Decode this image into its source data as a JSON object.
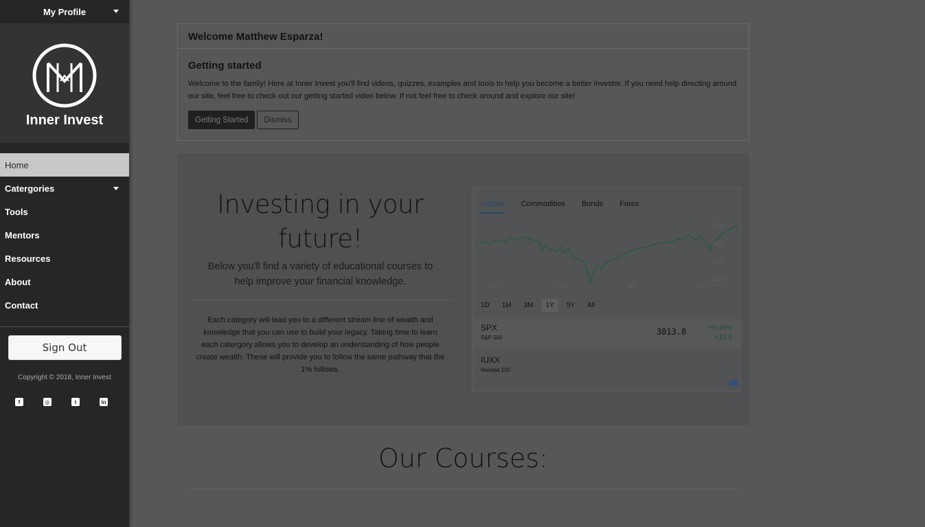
{
  "sidebar": {
    "profile_label": "My Profile",
    "brand_name": "Inner Invest",
    "nav": [
      {
        "label": "Home"
      },
      {
        "label": "Catergories"
      },
      {
        "label": "Tools"
      },
      {
        "label": "Mentors"
      },
      {
        "label": "Resources"
      },
      {
        "label": "About"
      },
      {
        "label": "Contact"
      }
    ],
    "sign_out": "Sign Out",
    "copyright": "Copyright © 2018, Inner Invest",
    "socials": [
      "facebook-icon",
      "instagram-icon",
      "twitter-icon",
      "linkedin-icon"
    ]
  },
  "welcome": {
    "header": "Welcome Matthew Esparza!",
    "title": "Getting started",
    "text": "Welcome to the family! Here at Inner Invest you'll find videos, quizzes, examples and tools to help you become a better investor. If you need help directing around our site, feel free to check out our getting started video below. If not feel free to check around and explore our site!",
    "primary_button": "Getting Started",
    "secondary_button": "Dismiss"
  },
  "hero": {
    "title": "Investing in your future!",
    "lead": "Below you'll find a variety of educational courses to help improve your financial knowledge.",
    "text": "Each category will lead you to a different stream line of wealth and knowledge that you can use to build your legacy. Taking time to learn each catergory allows you to develop an understanding of how people create wealth. These will provide you to follow the same pathway that the 1% follows."
  },
  "widget": {
    "tabs": [
      "Indices",
      "Commodities",
      "Bonds",
      "Forex"
    ],
    "active_tab": "Indices",
    "ranges": [
      "1D",
      "1M",
      "3M",
      "1Y",
      "5Y",
      "All"
    ],
    "active_range": "1Y",
    "quotes": [
      {
        "symbol": "SPX",
        "name": "S&P 500",
        "price": "3013.8",
        "change_pct": "+0.46%",
        "change": "+13.9"
      },
      {
        "symbol": "IUXX",
        "name": "Nasdaq 100"
      }
    ],
    "colors": {
      "line": "#1f5a3c",
      "accent": "#23486b"
    }
  },
  "courses": {
    "title": "Our Courses:"
  }
}
